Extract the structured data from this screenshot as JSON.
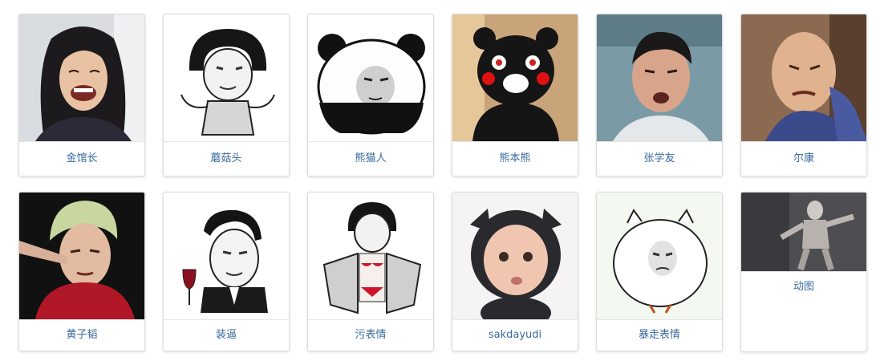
{
  "gallery": {
    "items": [
      {
        "label": "金馆长",
        "icon": "long-hair-laughing-man-photo"
      },
      {
        "label": "蘑菇头",
        "icon": "mushroom-head-shrug-cartoon"
      },
      {
        "label": "熊猫人",
        "icon": "panda-head-face-cartoon"
      },
      {
        "label": "熊本熊",
        "icon": "kumamon-bear-photo"
      },
      {
        "label": "张学友",
        "icon": "man-surprised-face-photo"
      },
      {
        "label": "尔康",
        "icon": "bald-man-grimace-photo"
      },
      {
        "label": "黄子韬",
        "icon": "blond-singer-pointing-photo"
      },
      {
        "label": "装逼",
        "icon": "suited-man-wine-glass-cartoon"
      },
      {
        "label": "污表情",
        "icon": "mushroom-head-bikini-cape-cartoon"
      },
      {
        "label": "sakdayudi",
        "icon": "baby-in-cat-costume-photo"
      },
      {
        "label": "暴走表情",
        "icon": "round-white-blob-face-cartoon"
      },
      {
        "label": "动图",
        "icon": "blurry-dancing-figure-gif"
      }
    ]
  },
  "colors": {
    "caption": "#3a6a9e",
    "border": "#dddddd"
  }
}
